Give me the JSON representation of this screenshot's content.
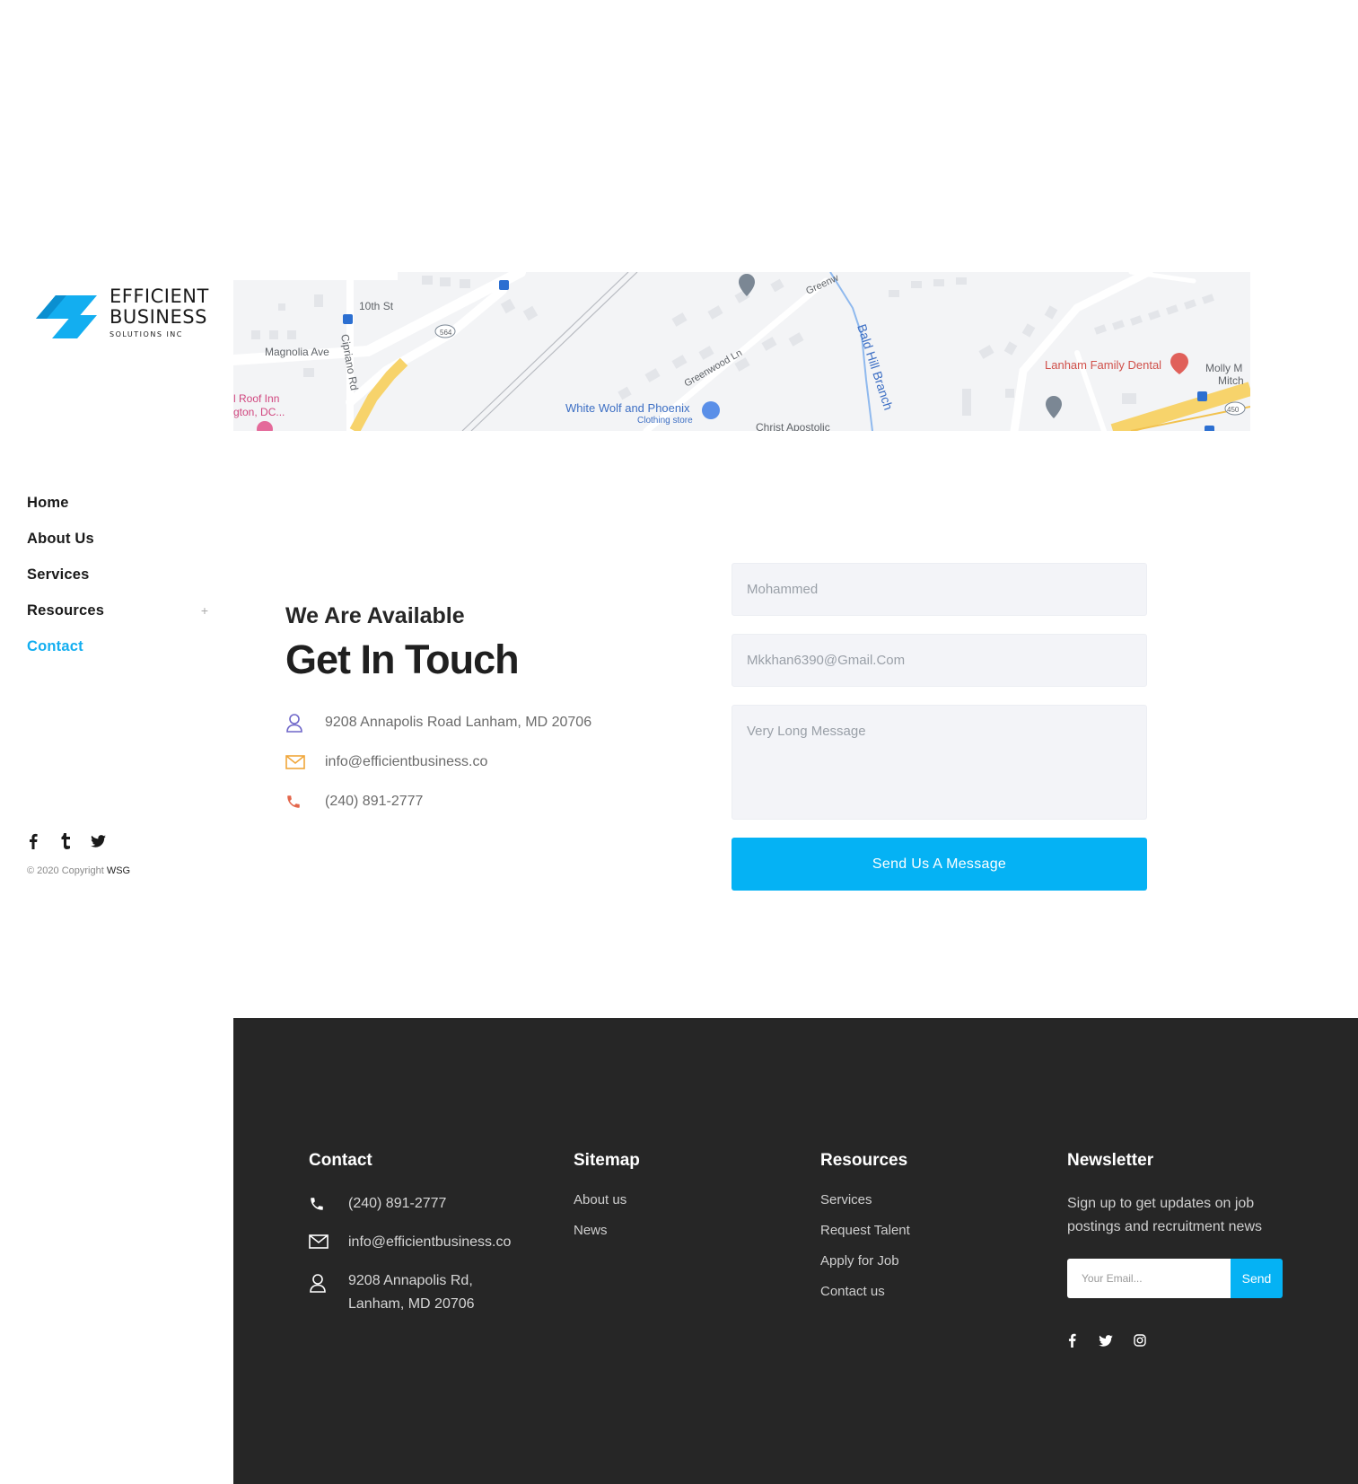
{
  "brand": {
    "line1": "EFFICIENT",
    "line2": "BUSINESS",
    "line3": "SOLUTIONS INC",
    "accent": "#13aef0"
  },
  "nav": {
    "items": [
      {
        "label": "Home"
      },
      {
        "label": "About Us"
      },
      {
        "label": "Services"
      },
      {
        "label": "Resources",
        "expand": "+"
      },
      {
        "label": "Contact"
      }
    ]
  },
  "sidebar_social": [
    "facebook-icon",
    "tumblr-icon",
    "twitter-icon"
  ],
  "copyright": {
    "text": "© 2020 Copyright",
    "owner": "WSG"
  },
  "map": {
    "labels": {
      "street1": "10th St",
      "street2": "Magnolia Ave",
      "street3": "Cipriano Rd",
      "route564": "564",
      "place1": "White Wolf and Phoenix",
      "place1_sub": "Clothing store",
      "street4": "Greenwood Ln",
      "street5": "Greenw",
      "branch": "Bald Hill Branch",
      "place2": "Christ Apostolic",
      "place3": "Lanham Family Dental",
      "place4a": "Molly M",
      "place4b": "Mitch",
      "route450": "450",
      "hotel_a": "l Roof Inn",
      "hotel_b": "gton, DC..."
    }
  },
  "contact": {
    "subtitle": "We Are Available",
    "title": "Get In Touch",
    "address": "9208 Annapolis Road Lanham, MD 20706",
    "email": "info@efficientbusiness.co",
    "phone": "(240) 891-2777"
  },
  "form": {
    "name_value": "Mohammed",
    "email_value": "Mkkhan6390@Gmail.Com",
    "message_value": "Very Long Message",
    "submit_label": "Send Us A Message"
  },
  "footer": {
    "contact": {
      "heading": "Contact",
      "phone": "(240) 891-2777",
      "email": "info@efficientbusiness.co",
      "address_line1": "9208 Annapolis Rd,",
      "address_line2": "Lanham, MD 20706"
    },
    "sitemap": {
      "heading": "Sitemap",
      "links": [
        "About us",
        "News"
      ]
    },
    "resources": {
      "heading": "Resources",
      "links": [
        "Services",
        "Request Talent",
        "Apply for Job",
        "Contact us"
      ]
    },
    "newsletter": {
      "heading": "Newsletter",
      "text": "Sign up to get updates on job postings and recruitment news",
      "placeholder": "Your Email...",
      "send_label": "Send"
    },
    "social": [
      "facebook-icon",
      "twitter-icon",
      "instagram-icon"
    ]
  }
}
